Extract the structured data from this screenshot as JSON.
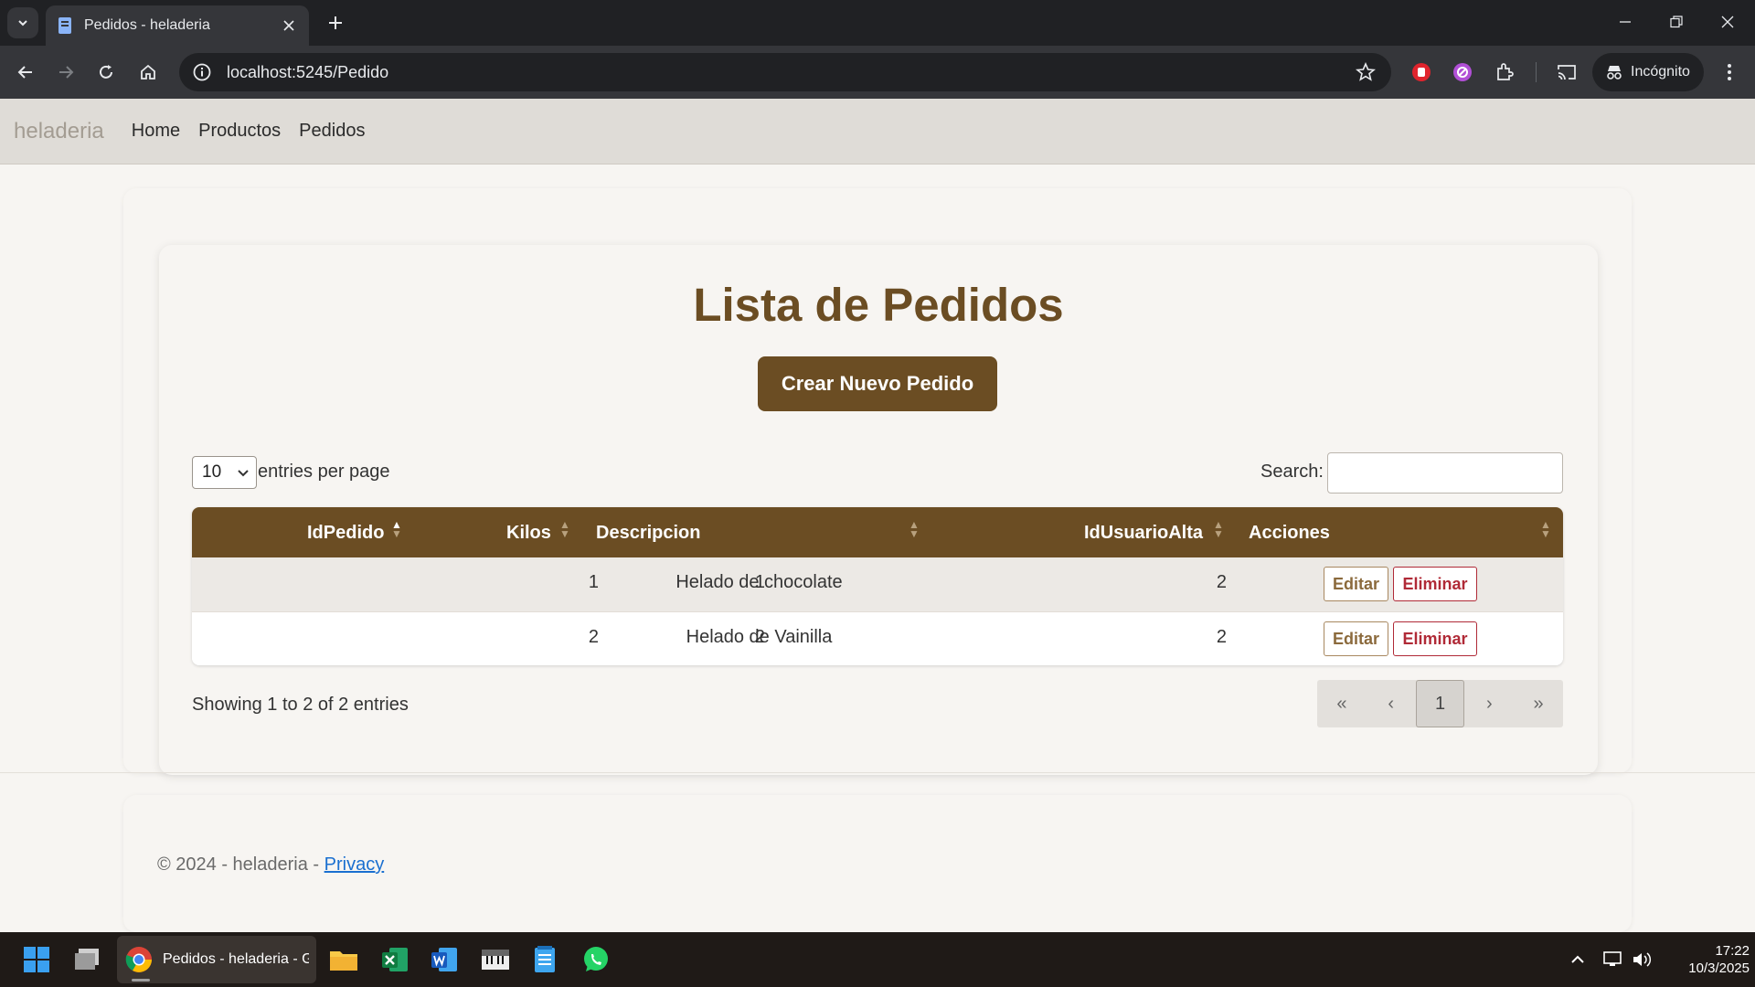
{
  "browser": {
    "tab_title": "Pedidos - heladeria",
    "url": "localhost:5245/Pedido",
    "incognito_label": "Incógnito"
  },
  "site": {
    "brand": "heladeria",
    "nav": [
      "Home",
      "Productos",
      "Pedidos"
    ]
  },
  "main": {
    "title": "Lista de Pedidos",
    "create_button": "Crear Nuevo Pedido",
    "entries_value": "10",
    "entries_label": "entries per page",
    "search_label": "Search:",
    "search_value": "",
    "columns": [
      "IdPedido",
      "Kilos",
      "Descripcion",
      "IdUsuarioAlta",
      "Acciones"
    ],
    "rows": [
      {
        "id": "1",
        "kilos": "1",
        "descripcion": "Helado de chocolate",
        "usuario": "2",
        "edit": "Editar",
        "delete": "Eliminar"
      },
      {
        "id": "2",
        "kilos": "2",
        "descripcion": "Helado de Vainilla",
        "usuario": "2",
        "edit": "Editar",
        "delete": "Eliminar"
      }
    ],
    "info": "Showing 1 to 2 of 2 entries",
    "pagination": {
      "first": "«",
      "prev": "‹",
      "current": "1",
      "next": "›",
      "last": "»"
    }
  },
  "footer": {
    "text": "© 2024 - heladeria - ",
    "privacy_link": "Privacy"
  },
  "taskbar": {
    "active_app": "Pedidos - heladeria - Google Chrome",
    "time": "17:22",
    "date": "10/3/2025"
  },
  "colors": {
    "brand_brown": "#6b4d23",
    "danger": "#b02a37",
    "link": "#1a6fd0"
  }
}
